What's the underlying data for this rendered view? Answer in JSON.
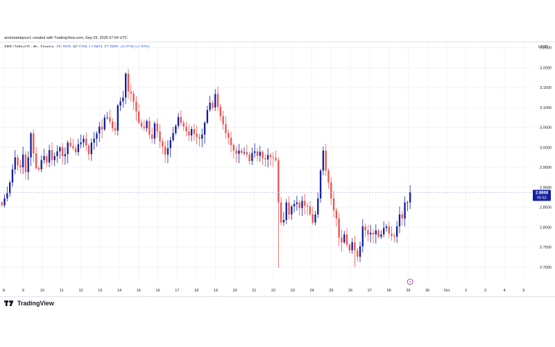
{
  "header": {
    "credit": "amirmalekpour1 created with TradingView.com, Sep 29, 2025 07:54 UTC"
  },
  "legend": {
    "symbol": "XRP / TetherUS · 4h · Binance",
    "open_label": "O",
    "open": "2.8635",
    "high_label": "H",
    "high": "2.9054",
    "low_label": "L",
    "low": "2.8454",
    "close_label": "C",
    "close": "2.8868",
    "change": "+0.0234 (+0.82%)"
  },
  "price_axis": {
    "currency": "USDT",
    "last_price": "2.8868",
    "countdown": "05:52"
  },
  "brand": {
    "name": "TradingView",
    "logo_icon": "tradingview-logo-icon"
  },
  "colors": {
    "up": "#131fa0",
    "down": "#ef5350",
    "grid": "#f0f3fa",
    "price_line": "#b2b5f5",
    "label_bg": "#131fa0"
  },
  "chart_data": {
    "type": "candlestick",
    "symbol": "XRP / TetherUS",
    "interval": "4h",
    "exchange": "Binance",
    "y_range": [
      2.665,
      3.265
    ],
    "y_ticks": [
      "3.2500",
      "3.2000",
      "3.1500",
      "3.1000",
      "3.0500",
      "3.0000",
      "2.9500",
      "2.9000",
      "2.8500",
      "2.8000",
      "2.7500",
      "2.7000"
    ],
    "x_range": [
      7.8,
      35.4
    ],
    "x_ticks": [
      {
        "day": 8,
        "label": "8"
      },
      {
        "day": 9,
        "label": "9"
      },
      {
        "day": 10,
        "label": "10"
      },
      {
        "day": 11,
        "label": "11"
      },
      {
        "day": 12,
        "label": "12"
      },
      {
        "day": 13,
        "label": "13"
      },
      {
        "day": 14,
        "label": "14"
      },
      {
        "day": 15,
        "label": "15"
      },
      {
        "day": 16,
        "label": "16"
      },
      {
        "day": 17,
        "label": "17"
      },
      {
        "day": 18,
        "label": "18"
      },
      {
        "day": 19,
        "label": "19"
      },
      {
        "day": 20,
        "label": "20"
      },
      {
        "day": 21,
        "label": "21"
      },
      {
        "day": 22,
        "label": "22"
      },
      {
        "day": 23,
        "label": "23"
      },
      {
        "day": 24,
        "label": "24"
      },
      {
        "day": 25,
        "label": "25"
      },
      {
        "day": 26,
        "label": "26"
      },
      {
        "day": 27,
        "label": "27"
      },
      {
        "day": 28,
        "label": "28"
      },
      {
        "day": 29,
        "label": "29"
      },
      {
        "day": 30,
        "label": "30"
      },
      {
        "day": 31,
        "label": "Oct"
      },
      {
        "day": 32,
        "label": "2"
      },
      {
        "day": 33,
        "label": "3"
      },
      {
        "day": 34,
        "label": "4"
      },
      {
        "day": 35,
        "label": "5"
      }
    ],
    "grid": true,
    "last_price": 2.8868,
    "event_marker_day": 29.1,
    "closes": [
      2.855,
      2.872,
      2.885,
      2.912,
      2.945,
      2.975,
      2.955,
      2.95,
      2.982,
      2.938,
      2.975,
      3.035,
      2.985,
      2.948,
      2.945,
      2.968,
      2.978,
      2.962,
      2.993,
      2.968,
      2.978,
      2.99,
      3.0,
      2.978,
      2.983,
      3.012,
      3.003,
      2.998,
      2.988,
      3.008,
      3.012,
      3.022,
      3.005,
      2.983,
      3.012,
      3.022,
      3.035,
      3.052,
      3.045,
      3.075,
      3.075,
      3.065,
      3.048,
      3.042,
      3.105,
      3.115,
      3.125,
      3.185,
      3.14,
      3.135,
      3.115,
      3.09,
      3.062,
      3.052,
      3.048,
      3.066,
      3.032,
      3.022,
      3.06,
      3.04,
      3.015,
      3.002,
      2.982,
      2.998,
      3.018,
      3.036,
      3.054,
      3.076,
      3.062,
      3.052,
      3.04,
      3.03,
      3.046,
      3.034,
      3.026,
      3.022,
      3.032,
      3.062,
      3.094,
      3.112,
      3.1,
      3.134,
      3.102,
      3.078,
      3.058,
      3.036,
      3.024,
      3.006,
      2.992,
      2.984,
      2.992,
      2.986,
      2.988,
      2.982,
      2.966,
      2.986,
      2.99,
      2.979,
      2.989,
      2.973,
      2.97,
      2.981,
      2.976,
      2.974,
      2.968,
      2.862,
      2.812,
      2.818,
      2.862,
      2.832,
      2.852,
      2.858,
      2.862,
      2.848,
      2.866,
      2.854,
      2.852,
      2.832,
      2.812,
      2.832,
      2.872,
      2.942,
      2.992,
      2.942,
      2.912,
      2.872,
      2.842,
      2.822,
      2.774,
      2.762,
      2.782,
      2.756,
      2.742,
      2.762,
      2.742,
      2.726,
      2.752,
      2.802,
      2.792,
      2.782,
      2.786,
      2.782,
      2.792,
      2.776,
      2.782,
      2.798,
      2.802,
      2.784,
      2.778,
      2.776,
      2.802,
      2.832,
      2.822,
      2.862,
      2.862,
      2.887
    ]
  }
}
